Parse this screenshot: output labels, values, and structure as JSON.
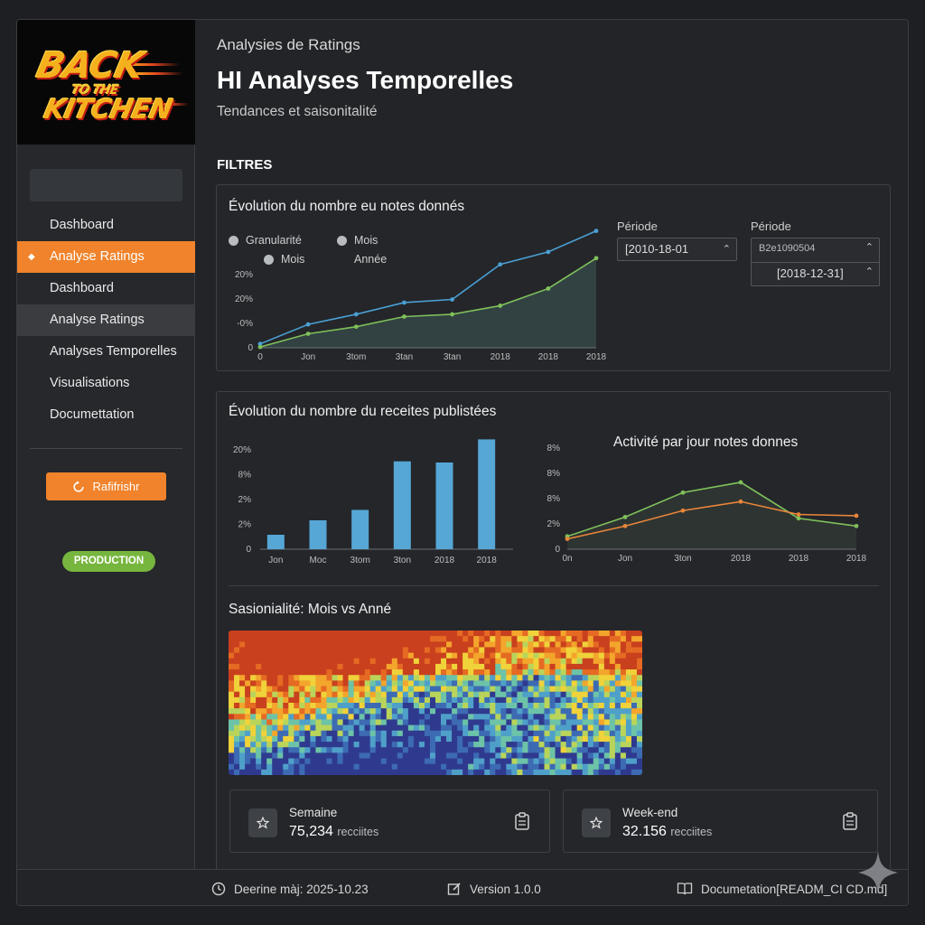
{
  "brand": {
    "logo_line1": "BACK",
    "logo_line2": "TO THE",
    "logo_line3": "KITCHEN"
  },
  "sidebar": {
    "items": [
      {
        "label": "Dashboard",
        "state": "normal"
      },
      {
        "label": "Analyse Ratings",
        "state": "active"
      },
      {
        "label": "Dashboard",
        "state": "normal"
      },
      {
        "label": "Analyse Ratings",
        "state": "hover"
      },
      {
        "label": "Analyses Temporelles",
        "state": "normal"
      },
      {
        "label": "Visualisations",
        "state": "normal"
      },
      {
        "label": "Documettation",
        "state": "normal"
      }
    ],
    "refresh_label": "Rafifrishr",
    "env_badge": "PRODUCTION"
  },
  "header": {
    "breadcrumb": "Analysies de Ratings",
    "title": "HI Analyses Temporelles",
    "subtitle": "Tendances et saisonitalité"
  },
  "filters": {
    "title": "FILTRES",
    "granularity": {
      "label": "Granularité",
      "options": [
        "Mois",
        "Mois",
        "Année"
      ]
    },
    "period1": {
      "label": "Période",
      "value": "[2010-18-01"
    },
    "period2": {
      "label": "Période",
      "value_top": "B2e1090504",
      "value_bottom": "[2018-12-31]"
    }
  },
  "colors": {
    "accent": "#f0832b",
    "blue": "#4a9fd3",
    "green": "#7fc05a",
    "orange": "#e8853a",
    "badge": "#77b63e"
  },
  "chart_data": [
    {
      "type": "line",
      "title": "Évolution du nombre eu notes donnés",
      "x": [
        "0",
        "Jon",
        "3tom",
        "3tan",
        "3tan",
        "2018",
        "2018",
        "2018"
      ],
      "y_ticks": [
        "0",
        "-0%",
        "20%",
        "20%"
      ],
      "series": [
        {
          "color": "#4a9fd3",
          "values": [
            0.5,
            3.0,
            4.3,
            5.8,
            6.2,
            10.7,
            12.3,
            15.0
          ]
        },
        {
          "color": "#7fc05a",
          "values": [
            0.1,
            1.8,
            2.7,
            4.0,
            4.3,
            5.4,
            7.6,
            11.5
          ]
        }
      ],
      "ylim": [
        0,
        16
      ]
    },
    {
      "type": "bar",
      "title": "Évolution du nombre du receites publistées",
      "categories": [
        "Jon",
        "Moc",
        "3tom",
        "3ton",
        "2018",
        "2018"
      ],
      "values": [
        2.5,
        5.0,
        6.8,
        15.2,
        15.0,
        19.0
      ],
      "y_ticks": [
        "0",
        "2%",
        "2%",
        "8%",
        "20%"
      ],
      "ylim": [
        0,
        20
      ]
    },
    {
      "type": "line",
      "title": "Activité par jour notes donnes",
      "x": [
        "0n",
        "Jon",
        "3ton",
        "2018",
        "2018",
        "2018"
      ],
      "y_ticks": [
        "0",
        "2%",
        "8%",
        "8%",
        "8%"
      ],
      "series": [
        {
          "color": "#7fc05a",
          "values": [
            1.0,
            2.5,
            4.4,
            5.2,
            2.4,
            1.8
          ]
        },
        {
          "color": "#e8853a",
          "values": [
            0.8,
            1.8,
            3.0,
            3.7,
            2.7,
            2.6
          ]
        }
      ],
      "ylim": [
        0,
        8
      ]
    },
    {
      "type": "heatmap",
      "title": "Sasionialité: Mois vs Anné"
    }
  ],
  "stats": [
    {
      "label": "Semaine",
      "value": "75,234",
      "unit": "recciites",
      "icon": "star-icon"
    },
    {
      "label": "Week-end",
      "value": "32.156",
      "unit": "recciites",
      "icon": "star-icon"
    }
  ],
  "footer": {
    "updated": "Deerine màj: 2025-10.23",
    "version": "Version 1.0.0",
    "docs": "Documetation[READM_CI CD.md]"
  }
}
